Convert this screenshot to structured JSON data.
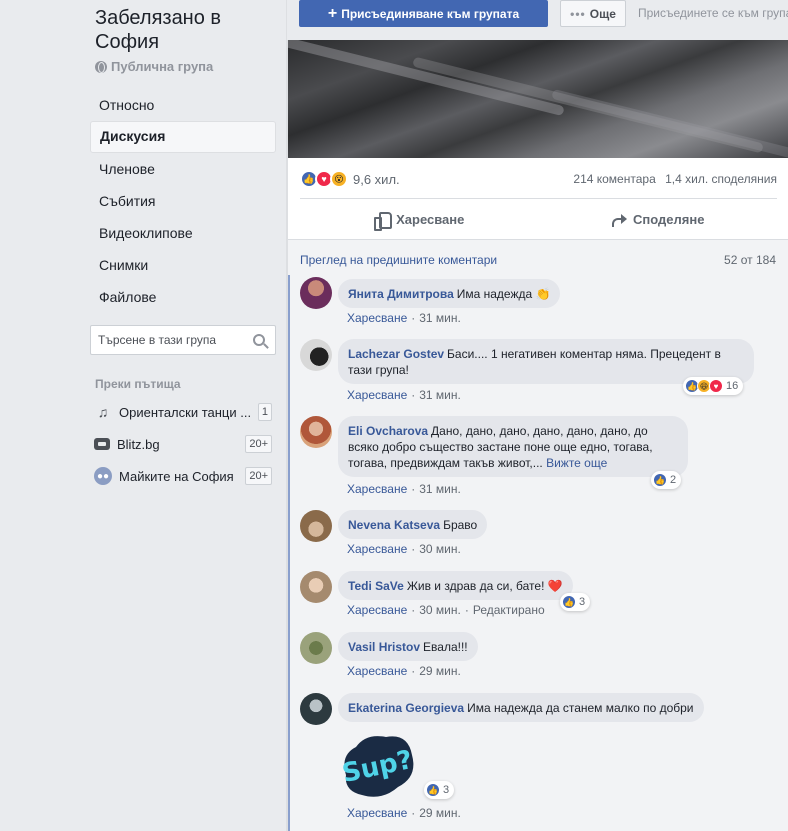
{
  "group": {
    "name": "Забелязано в София",
    "privacy": "Публична група"
  },
  "nav": [
    {
      "label": "Относно"
    },
    {
      "label": "Дискусия",
      "active": true
    },
    {
      "label": "Членове"
    },
    {
      "label": "Събития"
    },
    {
      "label": "Видеоклипове"
    },
    {
      "label": "Снимки"
    },
    {
      "label": "Файлове"
    }
  ],
  "search": {
    "placeholder": "Търсене в тази група"
  },
  "shortcuts": {
    "title": "Преки пътища",
    "items": [
      {
        "label": "Ориенталски танци ...",
        "count": "1",
        "icon": "music-note-icon"
      },
      {
        "label": "Blitz.bg",
        "count": "20+",
        "icon": "blitz-icon"
      },
      {
        "label": "Майките на София",
        "count": "20+",
        "icon": "group-icon"
      }
    ]
  },
  "topbar": {
    "join_label": "Присъединяване към групата",
    "more_label": "Още",
    "hint": "Присъединете се към групата"
  },
  "post": {
    "reactions_count": "9,6 хил.",
    "comments_count": "214 коментара",
    "shares_count": "1,4 хил. споделяния",
    "like_label": "Харесване",
    "share_label": "Споделяне",
    "prev_comments_label": "Преглед на предишните коментари",
    "comments_position": "52 от 184"
  },
  "comments": [
    {
      "author": "Янита Димитрова",
      "text": "Има надежда 👏",
      "like": "Харесване",
      "time": "31 мин."
    },
    {
      "author": "Lachezar Gostev",
      "text": "Баси.... 1 негативен коментар няма. Прецедент в тази група!",
      "like": "Харесване",
      "time": "31 мин.",
      "reactions": "16"
    },
    {
      "author": "Eli Ovcharova",
      "text": "Дано, дано, дано, дано, дано, дано, до всяко добро същество застане поне още едно, тогава, тогава, предвиждам такъв живот,...",
      "more": "Вижте още",
      "like": "Харесване",
      "time": "31 мин.",
      "reactions": "2"
    },
    {
      "author": "Nevena Katseva",
      "text": "Браво",
      "like": "Харесване",
      "time": "30 мин."
    },
    {
      "author": "Tedi SaVe",
      "text": "Жив и здрав да си, бате! ❤️",
      "like": "Харесване",
      "time": "30 мин.",
      "edited": "Редактирано",
      "reactions": "3"
    },
    {
      "author": "Vasil Hristov",
      "text": "Евала!!!",
      "like": "Харесване",
      "time": "29 мин."
    },
    {
      "author": "Ekaterina Georgieva",
      "text": "Има надежда да станем малко по добри",
      "like": "Харесване",
      "time": "29 мин.",
      "reactions": "3",
      "sticker": "Sup?"
    }
  ],
  "colors": {
    "fb_blue": "#4267b2",
    "link_blue": "#385898",
    "bubble_gray": "#e4e6eb",
    "sidebar_bg": "#e9ebee"
  }
}
